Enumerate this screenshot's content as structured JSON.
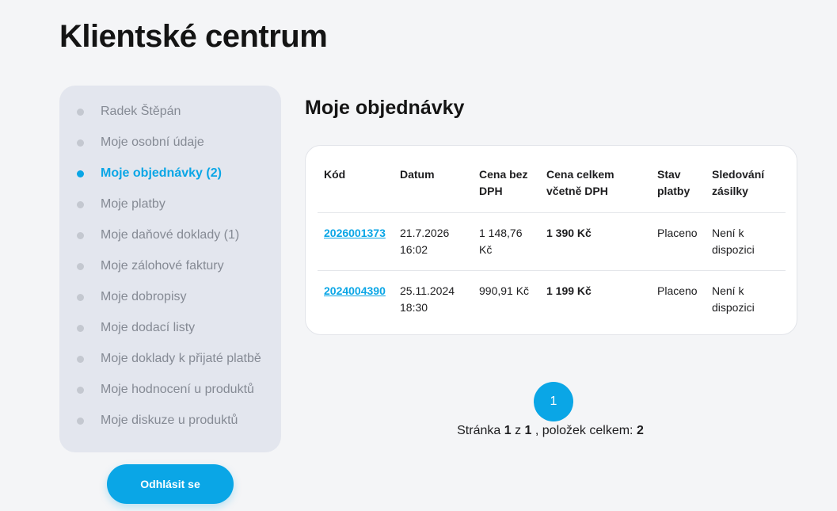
{
  "page": {
    "title": "Klientské centrum"
  },
  "sidebar": {
    "items": [
      {
        "label": "Radek Štěpán",
        "active": false
      },
      {
        "label": "Moje osobní údaje",
        "active": false
      },
      {
        "label": "Moje objednávky (2)",
        "active": true
      },
      {
        "label": "Moje platby",
        "active": false
      },
      {
        "label": "Moje daňové doklady (1)",
        "active": false
      },
      {
        "label": "Moje zálohové faktury",
        "active": false
      },
      {
        "label": "Moje dobropisy",
        "active": false
      },
      {
        "label": "Moje dodací listy",
        "active": false
      },
      {
        "label": "Moje doklady k přijaté platbě",
        "active": false
      },
      {
        "label": "Moje hodnocení u produktů",
        "active": false
      },
      {
        "label": "Moje diskuze u produktů",
        "active": false
      }
    ],
    "logout_label": "Odhlásit se"
  },
  "orders": {
    "title": "Moje objednávky",
    "columns": {
      "code": "Kód",
      "date": "Datum",
      "price_no_vat_1": "Cena bez",
      "price_no_vat_2": "DPH",
      "price_total_1": "Cena celkem",
      "price_total_2": "včetně DPH",
      "payment_1": "Stav",
      "payment_2": "platby",
      "tracking_1": "Sledování",
      "tracking_2": "zásilky"
    },
    "rows": [
      {
        "code": "2026001373",
        "date_1": "21.7.2026",
        "date_2": "16:02",
        "price_no_vat_1": "1 148,76",
        "price_no_vat_2": "Kč",
        "price_total": "1 390 Kč",
        "payment": "Placeno",
        "tracking_1": "Není k",
        "tracking_2": "dispozici"
      },
      {
        "code": "2024004390",
        "date_1": "25.11.2024",
        "date_2": "18:30",
        "price_no_vat_1": "990,91 Kč",
        "price_no_vat_2": "",
        "price_total": "1 199 Kč",
        "payment": "Placeno",
        "tracking_1": "Není k",
        "tracking_2": "dispozici"
      }
    ]
  },
  "pagination": {
    "current_page_button": "1",
    "page_word": "Stránka",
    "page_current": "1",
    "of_word": "z",
    "page_total": "1",
    "items_text": ", položek celkem:",
    "items_total": "2"
  },
  "colors": {
    "accent": "#0aa6e6",
    "sidebar_bg": "#e3e6ee",
    "page_bg": "#f4f5f7"
  }
}
